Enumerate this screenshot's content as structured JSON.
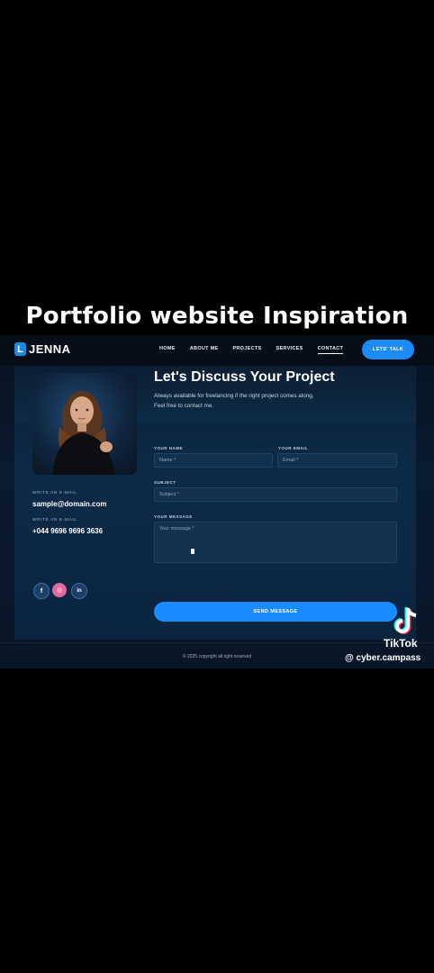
{
  "caption": "Portfolio website Inspiration",
  "nav": {
    "logo_mark": "L",
    "logo_text": "JENNA",
    "links": [
      "HOME",
      "ABOUT ME",
      "PROJECTS",
      "SERVICES",
      "CONTACT"
    ],
    "cta": "LETS' TALK"
  },
  "hero": {
    "title": "Let's Discuss Your Project",
    "subtitle_line1": "Always available for freelancing if the right project comes along,",
    "subtitle_line2": "Feel free to contact me."
  },
  "contact": {
    "email_label": "WRITE AN E-MAIL",
    "email": "sample@domain.com",
    "phone_label": "WRITE AN E-MAIL",
    "phone": "+044 9696 9696 3636"
  },
  "social": [
    {
      "icon": "facebook-icon",
      "glyph": "f",
      "color": "#1877f2"
    },
    {
      "icon": "instagram-icon",
      "glyph": "◎",
      "color": "#e1306c"
    },
    {
      "icon": "linkedin-icon",
      "glyph": "in",
      "color": "#0a66c2"
    }
  ],
  "form": {
    "name_label": "YOUR NAME",
    "name_placeholder": "Name *",
    "email_label": "YOUR EMAIL",
    "email_placeholder": "Email *",
    "subject_label": "SUBJECT",
    "subject_placeholder": "Subject *",
    "message_label": "YOUR MESSAGE",
    "message_placeholder": "Your message *",
    "submit": "SEND MESSAGE"
  },
  "footer": {
    "copyright": "© 2025 copyright all right reserved"
  },
  "watermark": {
    "name": "TikTok",
    "user": "@ cyber.campass"
  },
  "colors": {
    "accent": "#1a8cff",
    "background": "#0a1b2e"
  }
}
